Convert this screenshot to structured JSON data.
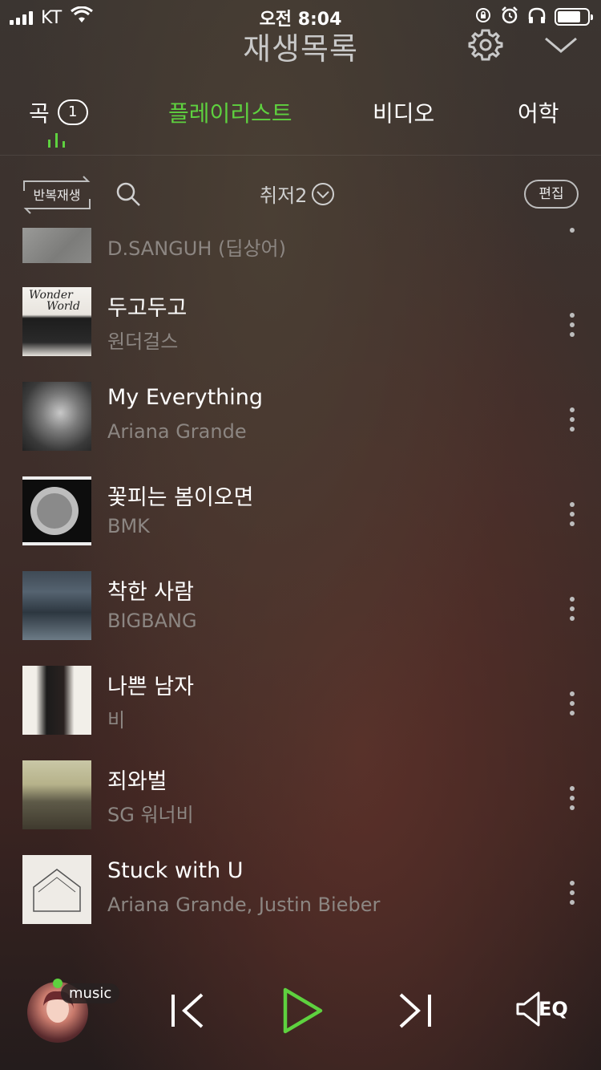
{
  "status_bar": {
    "carrier": "KT",
    "time": "오전 8:04"
  },
  "header": {
    "title": "재생목록"
  },
  "tabs": [
    {
      "label": "곡",
      "badge": "1",
      "active": false
    },
    {
      "label": "플레이리스트",
      "active": true
    },
    {
      "label": "비디오",
      "active": false
    },
    {
      "label": "어학",
      "active": false
    }
  ],
  "controls": {
    "repeat_label": "반복재생",
    "sort_label": "취저2",
    "edit_label": "편집"
  },
  "songs": [
    {
      "title": "",
      "artist": "D.SANGUH (딥상어)"
    },
    {
      "title": "두고두고",
      "artist": "원더걸스"
    },
    {
      "title": "My Everything",
      "artist": "Ariana Grande"
    },
    {
      "title": "꽃피는 봄이오면",
      "artist": "BMK"
    },
    {
      "title": "착한 사람",
      "artist": "BIGBANG"
    },
    {
      "title": "나쁜 남자",
      "artist": "비"
    },
    {
      "title": "죄와벌",
      "artist": "SG 워너비"
    },
    {
      "title": "Stuck with U",
      "artist": "Ariana Grande, Justin Bieber"
    }
  ],
  "player": {
    "source_label": "music",
    "eq_label": "EQ"
  },
  "colors": {
    "accent": "#5ed13f",
    "secondary_text": "#8c8682"
  }
}
